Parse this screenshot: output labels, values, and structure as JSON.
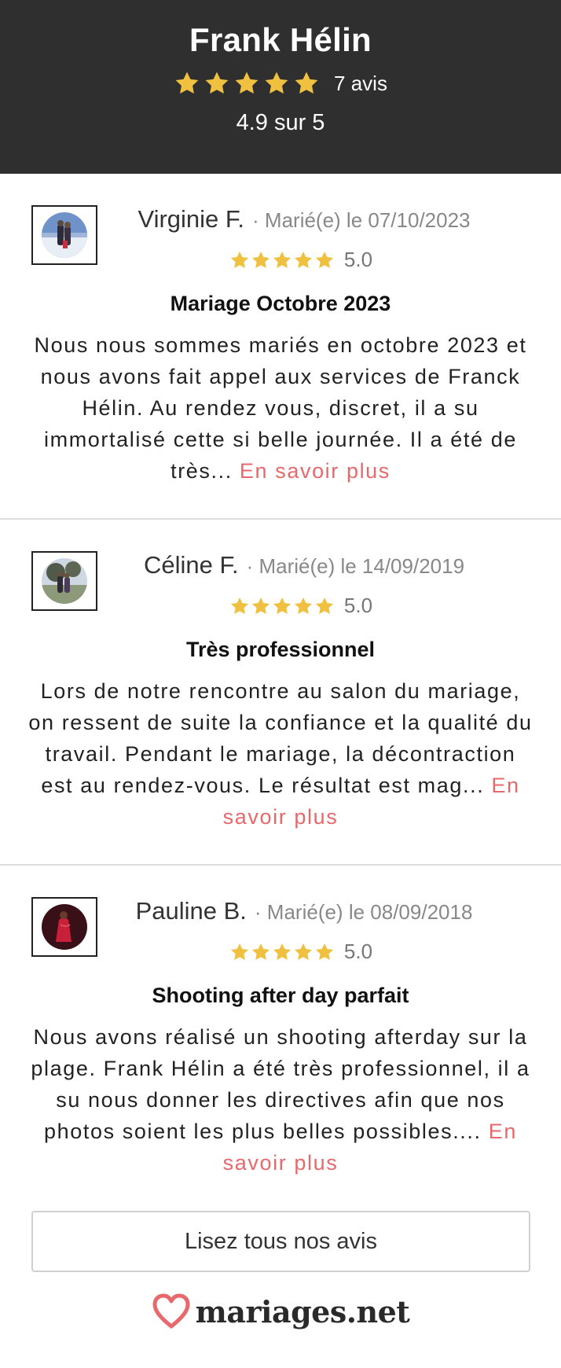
{
  "header": {
    "title": "Frank Hélin",
    "stars": 5,
    "count_label": "7 avis",
    "score_label": "4.9 sur 5"
  },
  "colors": {
    "header_bg": "#2f2f2f",
    "star": "#f0c040",
    "link": "#e8686b"
  },
  "reviews": [
    {
      "name": "Virginie F.",
      "date": "· Marié(e) le 07/10/2023",
      "rating": "5.0",
      "title": "Mariage Octobre 2023",
      "text": "Nous nous sommes mariés en octobre 2023 et nous avons fait appel aux services de Franck Hélin. Au rendez vous, discret, il a su immortalisé cette si belle journée. Il a été de très...",
      "more": "En savoir plus",
      "avatar_icon": "couple-snow-photo-icon"
    },
    {
      "name": "Céline F.",
      "date": "· Marié(e) le 14/09/2019",
      "rating": "5.0",
      "title": "Très professionnel",
      "text": "Lors de notre rencontre au salon du mariage, on ressent de suite la confiance et la qualité du travail. Pendant le mariage, la décontraction est au rendez-vous. Le résultat est mag...",
      "more": "En savoir plus",
      "avatar_icon": "couple-outdoor-photo-icon"
    },
    {
      "name": "Pauline B.",
      "date": "· Marié(e) le 08/09/2018",
      "rating": "5.0",
      "title": "Shooting after day parfait",
      "text": "Nous avons réalisé un shooting afterday sur la plage. Frank Hélin a été très professionnel, il a su nous donner les directives afin que nos photos soient les plus belles possibles....",
      "more": "En savoir plus",
      "avatar_icon": "woman-red-dress-photo-icon"
    }
  ],
  "button_label": "Lisez tous nos avis",
  "logo_text": "mariages.net"
}
